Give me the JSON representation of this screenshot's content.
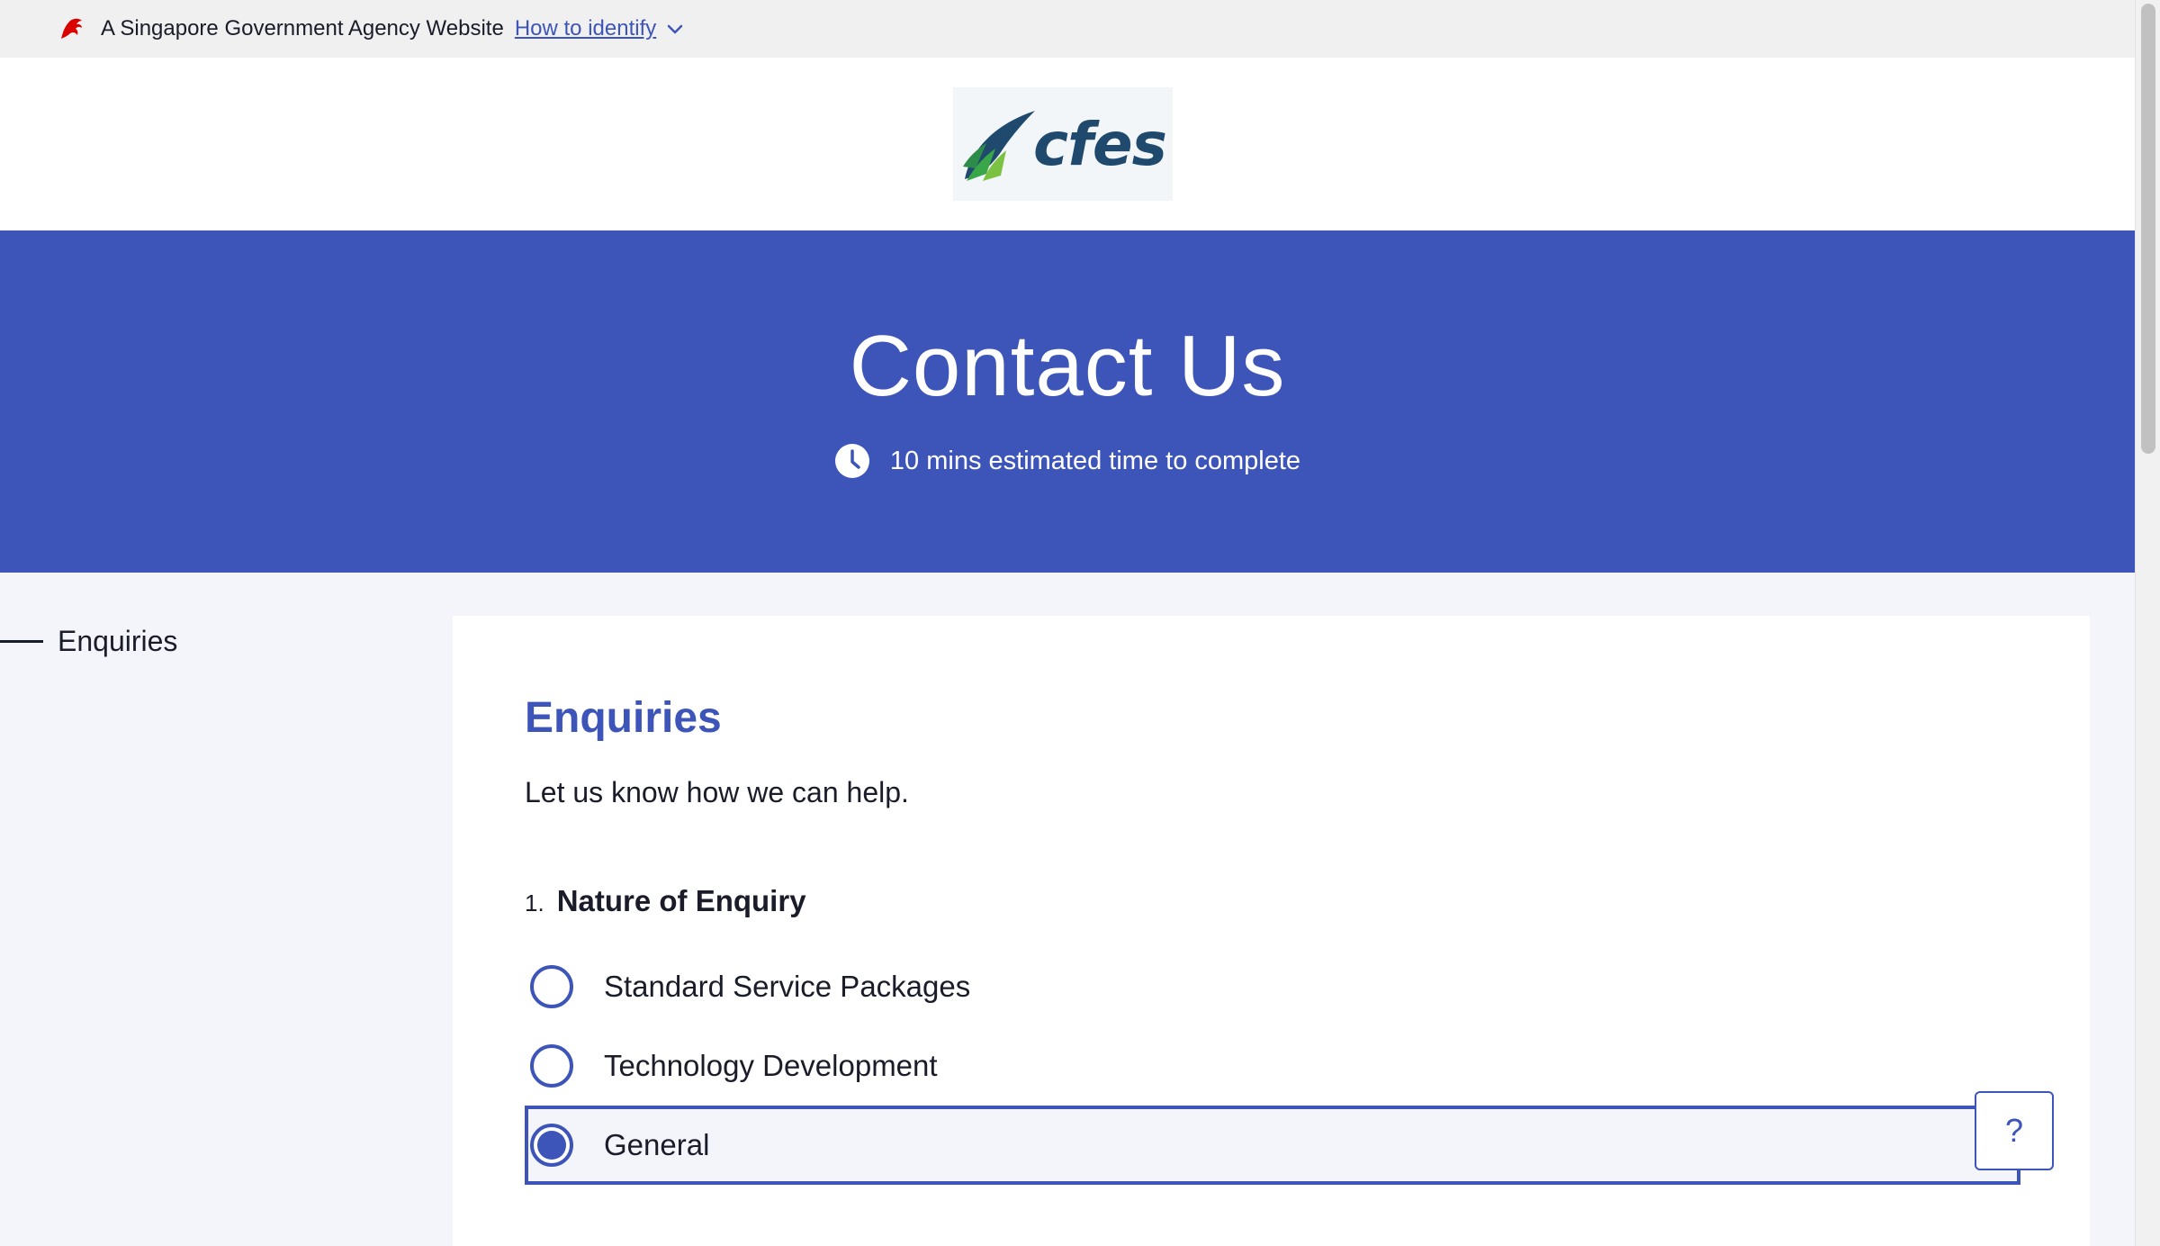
{
  "masthead": {
    "agency_text": "A Singapore Government Agency Website",
    "identify_link": "How to identify",
    "lion_color": "#db0000"
  },
  "header": {
    "logo_text": "cfes"
  },
  "hero": {
    "title": "Contact Us",
    "eta": "10 mins estimated time to complete",
    "background": "#3d55b9"
  },
  "sidebar": {
    "items": [
      {
        "label": "Enquiries",
        "active": true
      }
    ]
  },
  "section": {
    "title": "Enquiries",
    "description": "Let us know how we can help."
  },
  "question": {
    "number": "1.",
    "label": "Nature of Enquiry",
    "options": [
      {
        "label": "Standard Service Packages",
        "selected": false
      },
      {
        "label": "Technology Development",
        "selected": false
      },
      {
        "label": "General",
        "selected": true
      }
    ]
  },
  "help_button": {
    "label": "?"
  },
  "colors": {
    "accent": "#3d55b9",
    "text": "#1a1c2a",
    "page_bg": "#f4f5fa"
  }
}
